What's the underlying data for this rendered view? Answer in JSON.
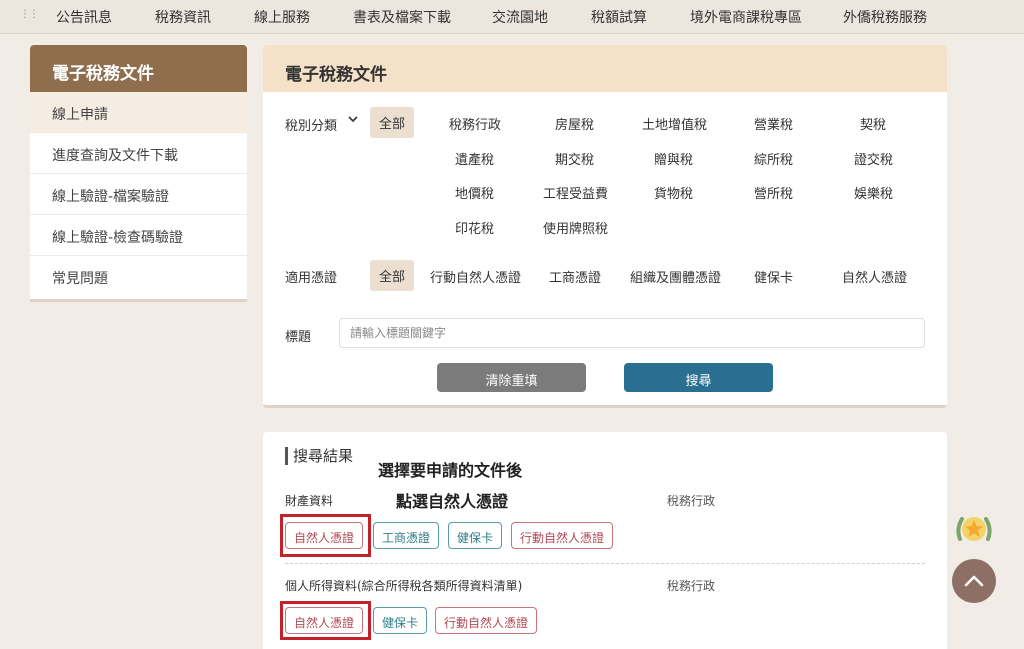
{
  "nav": {
    "items": [
      "公告訊息",
      "稅務資訊",
      "線上服務",
      "書表及檔案下載",
      "交流園地",
      "稅額試算",
      "境外電商課稅專區",
      "外僑稅務服務"
    ]
  },
  "sidebar": {
    "title": "電子稅務文件",
    "items": [
      "線上申請",
      "進度查詢及文件下載",
      "線上驗證-檔案驗證",
      "線上驗證-檢查碼驗證",
      "常見問題"
    ]
  },
  "panel": {
    "title": "電子稅務文件",
    "tax_category_label": "稅別分類",
    "all_label": "全部",
    "tax_options": [
      "稅務行政",
      "房屋稅",
      "土地增值稅",
      "營業稅",
      "契稅",
      "遺產稅",
      "期交稅",
      "贈與稅",
      "綜所稅",
      "證交稅",
      "地價稅",
      "工程受益費",
      "貨物稅",
      "營所稅",
      "娛樂稅",
      "印花稅",
      "使用牌照稅"
    ],
    "cert_label": "適用憑證",
    "cert_all_label": "全部",
    "cert_options": [
      "行動自然人憑證",
      "工商憑證",
      "組織及團體憑證",
      "健保卡",
      "自然人憑證"
    ],
    "title_label": "標題",
    "search_placeholder": "請輸入標題關鍵字",
    "clear_button": "清除重填",
    "search_button": "搜尋"
  },
  "results": {
    "title": "搜尋結果",
    "docs": [
      {
        "name": "財產資料",
        "category": "稅務行政",
        "tags": [
          "自然人憑證",
          "工商憑證",
          "健保卡",
          "行動自然人憑證"
        ]
      },
      {
        "name": "個人所得資料(綜合所得稅各類所得資料清單)",
        "category": "稅務行政",
        "tags": [
          "自然人憑證",
          "健保卡",
          "行動自然人憑證"
        ]
      }
    ]
  },
  "annotation": {
    "line1": "選擇要申請的文件後",
    "line2": "點選自然人憑證"
  },
  "colors": {
    "sidebar_header": "#8f6e4e",
    "panel_header": "#f4e1c7",
    "search_button": "#2a6f91",
    "clear_button": "#7b7b7b",
    "highlight": "#c4222a"
  }
}
